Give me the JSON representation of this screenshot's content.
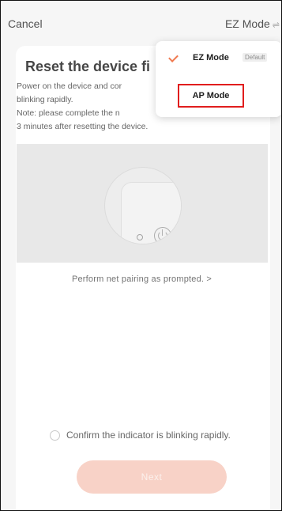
{
  "topbar": {
    "cancel_label": "Cancel",
    "mode_label": "EZ Mode",
    "swap_icon": "⇌"
  },
  "main": {
    "title": "Reset the device fi",
    "description_lines": [
      "Power on the device and cor",
      "blinking rapidly.",
      "Note: please complete the n",
      "3 minutes after resetting the device."
    ],
    "pairing_link": "Perform net pairing as prompted. >",
    "confirm_label": "Confirm the indicator is blinking rapidly.",
    "next_label": "Next"
  },
  "dropdown": {
    "ez_label": "EZ Mode",
    "default_badge": "Default",
    "ap_label": "AP Mode"
  },
  "colors": {
    "accent": "#f07a50",
    "next_button_disabled": "#f7c9bb",
    "highlight_border": "#e11d1d"
  },
  "icons": {
    "check": "check-icon",
    "swap": "swap-arrows-icon",
    "power": "power-icon"
  }
}
